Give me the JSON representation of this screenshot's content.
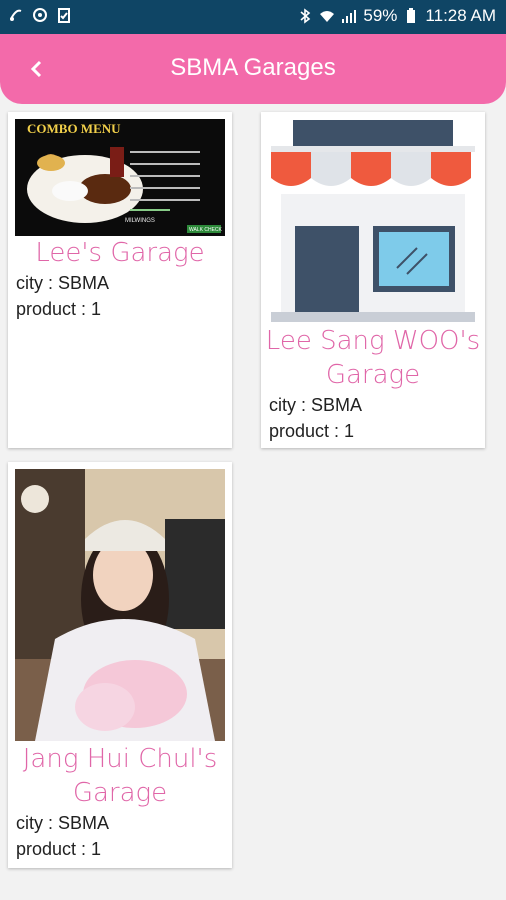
{
  "status_bar": {
    "battery": "59%",
    "time": "11:28 AM"
  },
  "header": {
    "title": "SBMA Garages"
  },
  "garages": [
    {
      "name": "Lee's Garage",
      "city": "city : SBMA",
      "product": "product : 1",
      "image": "combo-menu-image"
    },
    {
      "name": "Lee Sang WOO's Garage",
      "city": "city : SBMA",
      "product": "product : 1",
      "image": "shop-storefront-image"
    },
    {
      "name": "Jang Hui Chul's Garage",
      "city": "city : SBMA",
      "product": "product : 1",
      "image": "person-photo"
    }
  ],
  "combo_menu": {
    "title": "COMBO MENU",
    "brand": "MILWINGS",
    "badge": "WALK CHECK"
  },
  "colors": {
    "status_bar": "#0f4565",
    "app_bar": "#f36aaa",
    "name": "#e066a8"
  }
}
